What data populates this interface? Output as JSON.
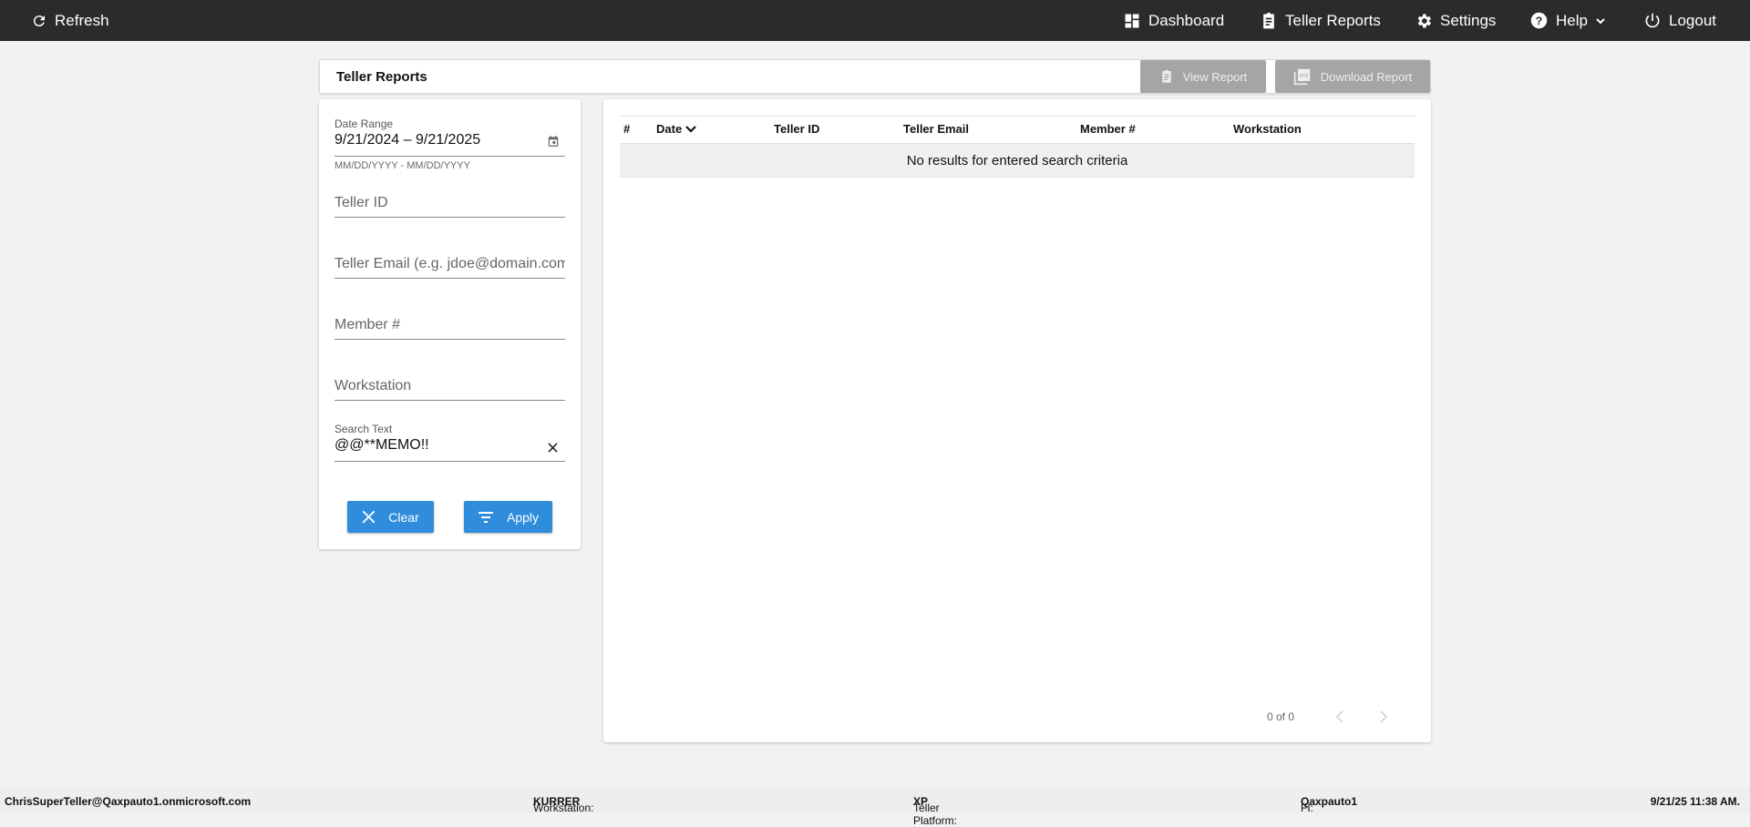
{
  "topbar": {
    "refresh": "Refresh",
    "dashboard": "Dashboard",
    "teller_reports": "Teller Reports",
    "settings": "Settings",
    "help": "Help",
    "logout": "Logout"
  },
  "page": {
    "title": "Teller Reports",
    "view_report": "View Report",
    "download_report": "Download Report"
  },
  "filters": {
    "date_range_label": "Date Range",
    "date_range_value": "9/21/2024 – 9/21/2025",
    "date_hint": "MM/DD/YYYY - MM/DD/YYYY",
    "teller_id_placeholder": "Teller ID",
    "teller_email_placeholder": "Teller Email (e.g. jdoe@domain.com)",
    "member_placeholder": "Member #",
    "workstation_placeholder": "Workstation",
    "search_label": "Search Text",
    "search_value": "@@**MEMO!!",
    "clear": "Clear",
    "apply": "Apply"
  },
  "table": {
    "columns": [
      "#",
      "Date",
      "Teller ID",
      "Teller Email",
      "Member #",
      "Workstation"
    ],
    "empty": "No results for entered search criteria",
    "pagination": "0 of 0"
  },
  "footer": {
    "user": "ChrisSuperTeller@Qaxpauto1.onmicrosoft.com",
    "workstation_label": "Workstation: ",
    "workstation": "KURRER",
    "platform_label": "Teller Platform: ",
    "platform": "XP",
    "fi_label": "FI: ",
    "fi": "Qaxpauto1",
    "datetime": "9/21/25 11:38 AM."
  },
  "colors": {
    "accent": "#2f8ddc",
    "topbar": "#2b2b2b"
  }
}
